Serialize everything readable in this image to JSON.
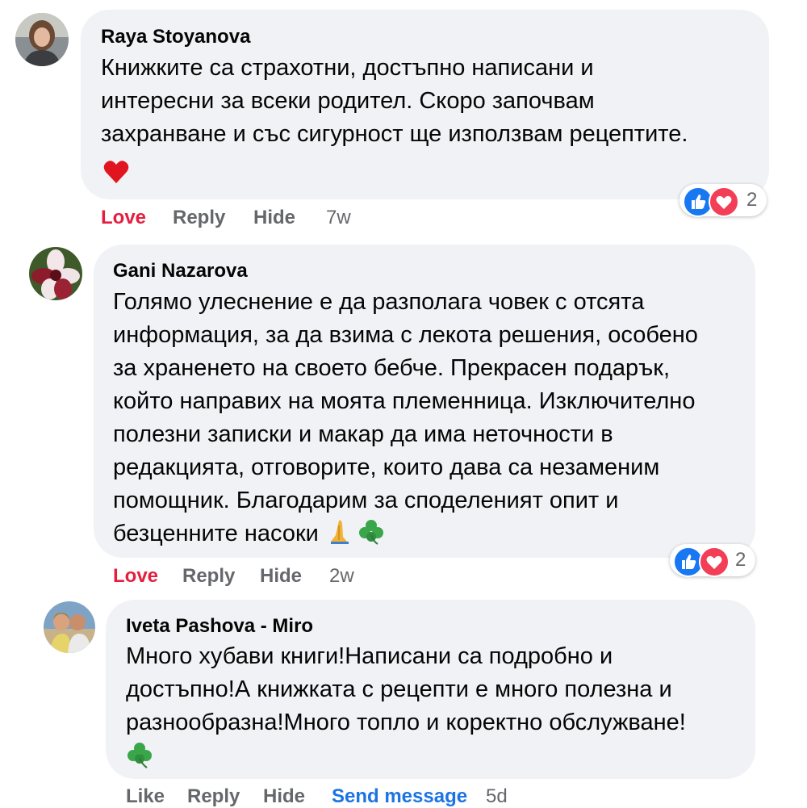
{
  "comments": [
    {
      "author": "Raya Stoyanova",
      "lines": [
        "Книжките са страхотни, достъпно написани и",
        "интересни за всеки родител. Скоро започвам",
        "захранване и със сигурност ще използвам рецептите."
      ],
      "emoji": "heart-emoji",
      "actions": {
        "reaction": "Love",
        "reply": "Reply",
        "hide": "Hide",
        "time": "7w"
      },
      "reaction_count": "2",
      "reactions": [
        "like-icon",
        "love-icon"
      ]
    },
    {
      "author": "Gani Nazarova",
      "lines": [
        "Голямо улеснение е да разполага човек с отсята",
        "информация, за да взима с леко­та решения, особено",
        "за храненето на своето бебче. Прекрасен подарък,",
        "който направих на моята племенница. Изключително",
        "полезни записки и макар да има неточности в",
        "редакцията, отговорите, които дава са незаменим",
        "помощник. Благодарим за споделеният опит и",
        "безценните насоки"
      ],
      "emoji": "pray-and-shamrock-emoji",
      "actions": {
        "reaction": "Love",
        "reply": "Reply",
        "hide": "Hide",
        "time": "2w"
      },
      "reaction_count": "2",
      "reactions": [
        "like-icon",
        "love-icon"
      ]
    },
    {
      "author": "Iveta Pashova - Miro",
      "lines": [
        "Много хубави книги!Написани са подробно и",
        "достъпно!А книжката с рецепти е много полезна и",
        "разнообразна!Много топло и коректно обслужване!"
      ],
      "emoji": "shamrock-emoji",
      "actions": {
        "reaction": "Like",
        "reply": "Reply",
        "hide": "Hide",
        "send": "Send message",
        "time": "5d"
      }
    }
  ],
  "colors": {
    "bubble": "#f0f2f5",
    "love": "#e41e3f",
    "like": "#1b74e4",
    "muted": "#65676b"
  }
}
